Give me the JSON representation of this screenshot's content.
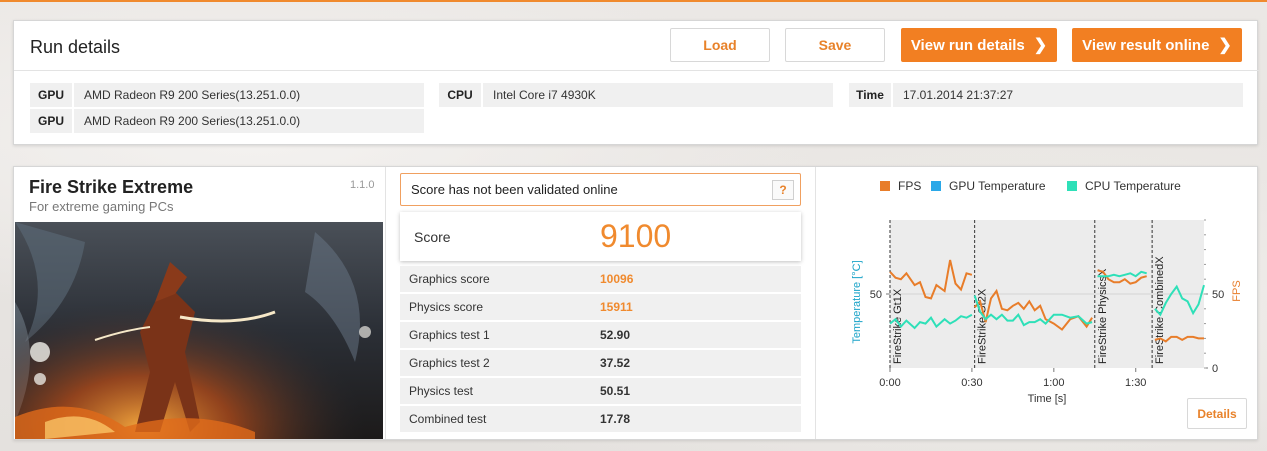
{
  "run_details": {
    "title": "Run details",
    "buttons": {
      "load": "Load",
      "save": "Save",
      "view_run_details": "View run details",
      "view_result_online": "View result online"
    },
    "gpu_key": "GPU",
    "gpu_values": [
      "AMD Radeon R9 200 Series(13.251.0.0)",
      "AMD Radeon R9 200 Series(13.251.0.0)"
    ],
    "cpu_key": "CPU",
    "cpu_value": "Intel Core i7 4930K",
    "time_key": "Time",
    "time_value": "17.01.2014 21:37:27"
  },
  "test": {
    "name": "Fire Strike Extreme",
    "subtitle": "For extreme gaming PCs",
    "version": "1.1.0"
  },
  "validation": {
    "message": "Score has not been validated online",
    "help": "?"
  },
  "score": {
    "label": "Score",
    "value": "9100"
  },
  "metrics": [
    {
      "label": "Graphics score",
      "value": "10096",
      "highlight": true
    },
    {
      "label": "Physics score",
      "value": "15911",
      "highlight": true
    },
    {
      "label": "Graphics test 1",
      "value": "52.90",
      "highlight": false
    },
    {
      "label": "Graphics test 2",
      "value": "37.52",
      "highlight": false
    },
    {
      "label": "Physics test",
      "value": "50.51",
      "highlight": false
    },
    {
      "label": "Combined test",
      "value": "17.78",
      "highlight": false
    }
  ],
  "chart": {
    "legend": [
      "FPS",
      "GPU Temperature",
      "CPU Temperature"
    ],
    "colors": {
      "fps": "#e87d2a",
      "gpu": "#2aa8e8",
      "cpu": "#2ee0b8"
    },
    "details_label": "Details"
  },
  "chart_data": {
    "type": "line",
    "xlabel": "Time [s]",
    "ylabel_left": "Temperature [°C]",
    "ylabel_right": "FPS",
    "x_ticks": [
      "0:00",
      "0:30",
      "1:00",
      "1:30"
    ],
    "x_tick_values": [
      0,
      30,
      60,
      90
    ],
    "xlim": [
      0,
      115
    ],
    "y_left_ticks": [
      "50"
    ],
    "y_left_tick_values": [
      50
    ],
    "ylim_left": [
      0,
      100
    ],
    "y_right_ticks": [
      "50",
      "0"
    ],
    "y_right_tick_values": [
      50,
      0
    ],
    "ylim_right": [
      0,
      100
    ],
    "sections": [
      {
        "label": "FireStrike Gt1X",
        "x": 0
      },
      {
        "label": "FireStrike Gt2X",
        "x": 31
      },
      {
        "label": "FireStrike PhysicsX",
        "x": 75
      },
      {
        "label": "FireStrike CombinedX",
        "x": 96
      }
    ],
    "series": [
      {
        "name": "FPS",
        "segments": [
          {
            "x": [
              0,
              2,
              4,
              6,
              9,
              11,
              13,
              15,
              17,
              20,
              22,
              24,
              26,
              28,
              30
            ],
            "y": [
              65,
              61,
              60,
              64,
              56,
              58,
              48,
              47,
              56,
              52,
              73,
              57,
              53,
              64,
              63
            ]
          },
          {
            "x": [
              31,
              33,
              35,
              37,
              39,
              41,
              43,
              45,
              47,
              49,
              51,
              53,
              55,
              57,
              60,
              63,
              66,
              69,
              72,
              74
            ],
            "y": [
              41,
              45,
              31,
              47,
              52,
              40,
              39,
              42,
              44,
              40,
              45,
              39,
              42,
              33,
              30,
              26,
              33,
              35,
              28,
              34
            ]
          },
          {
            "x": [
              76,
              78,
              80,
              82,
              84,
              86,
              88,
              90,
              92,
              94
            ],
            "y": [
              66,
              65,
              60,
              58,
              58,
              60,
              57,
              58,
              61,
              62
            ]
          },
          {
            "x": [
              97,
              99,
              101,
              103,
              105,
              107,
              109,
              111,
              113,
              115
            ],
            "y": [
              19,
              20,
              18,
              21,
              21,
              19,
              21,
              21,
              20,
              20
            ]
          }
        ]
      },
      {
        "name": "CPU Temperature",
        "segments": [
          {
            "x": [
              0,
              2,
              4,
              6,
              9,
              11,
              13,
              15,
              17,
              20,
              22,
              24,
              26,
              28,
              30
            ],
            "y": [
              30,
              33,
              28,
              32,
              27,
              31,
              30,
              34,
              28,
              33,
              30,
              32,
              35,
              34,
              36
            ]
          },
          {
            "x": [
              31,
              33,
              35,
              37,
              39,
              41,
              43,
              45,
              47,
              49,
              51,
              53,
              55,
              57,
              60,
              63,
              66,
              69,
              72,
              74
            ],
            "y": [
              49,
              38,
              33,
              36,
              33,
              36,
              32,
              32,
              36,
              29,
              31,
              31,
              33,
              30,
              36,
              36,
              34,
              35,
              30,
              31
            ]
          },
          {
            "x": [
              76,
              78,
              80,
              82,
              84,
              86,
              88,
              90,
              92,
              94
            ],
            "y": [
              62,
              62,
              62,
              63,
              62,
              63,
              64,
              62,
              65,
              64
            ]
          },
          {
            "x": [
              97,
              99,
              101,
              103,
              105,
              107,
              109,
              111,
              113,
              115
            ],
            "y": [
              40,
              36,
              44,
              50,
              55,
              47,
              45,
              37,
              43,
              56
            ]
          }
        ]
      }
    ]
  }
}
